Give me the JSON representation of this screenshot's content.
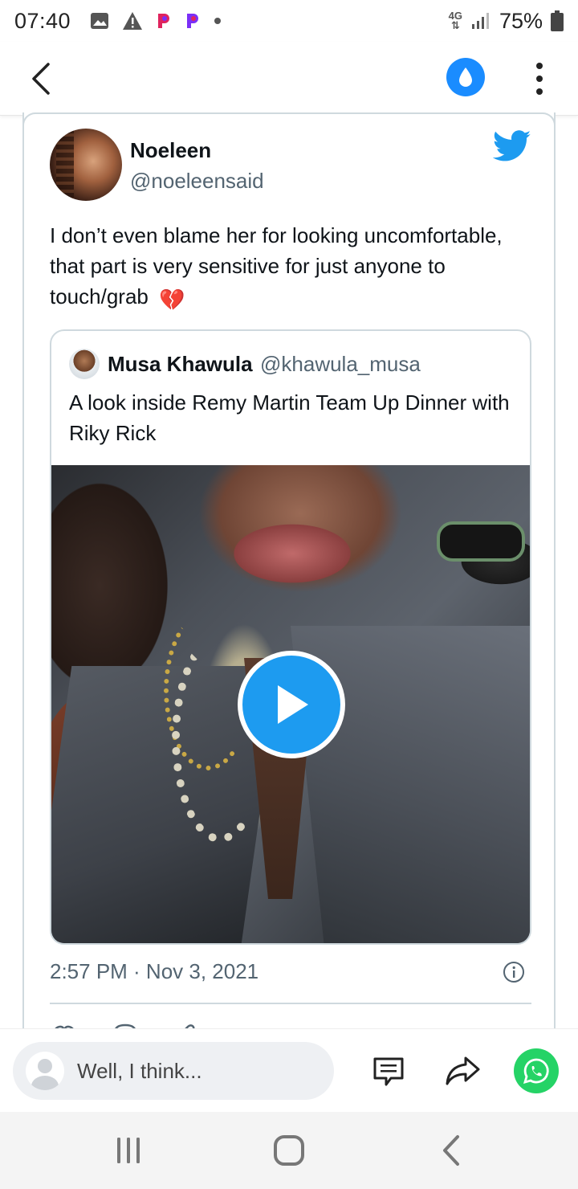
{
  "status_bar": {
    "time": "07:40",
    "network": "4G",
    "battery_percent": "75%",
    "notification_icons": [
      "gallery-icon",
      "warning-icon",
      "p-app-icon",
      "p-app-icon",
      "dot-icon"
    ]
  },
  "top_bar": {
    "back_icon": "chevron-left-icon",
    "drop_icon": "water-drop-icon",
    "menu_icon": "more-vertical-icon",
    "accent_color": "#1a8cff"
  },
  "tweet": {
    "author_name": "Noeleen",
    "author_handle": "@noeleensaid",
    "text": "I don’t even blame her for looking uncomfortable, that part is very sensitive for just anyone to touch/grab",
    "emoji": "💔",
    "timestamp": "2:57 PM · Nov 3, 2021",
    "brand_icon": "twitter-bird-icon",
    "brand_color": "#1d9bf0",
    "quoted": {
      "author_name": "Musa Khawula",
      "author_handle": "@khawula_musa",
      "text": "A look inside Remy Martin Team Up Dinner with Riky Rick",
      "media_type": "video",
      "play_icon": "play-icon"
    }
  },
  "comment_bar": {
    "placeholder": "Well, I think...",
    "comment_icon": "comment-icon",
    "share_icon": "share-icon",
    "whatsapp_icon": "whatsapp-icon",
    "whatsapp_color": "#25d366"
  },
  "nav_bar": {
    "recents_icon": "recents-icon",
    "home_icon": "home-icon",
    "back_icon": "back-icon"
  }
}
